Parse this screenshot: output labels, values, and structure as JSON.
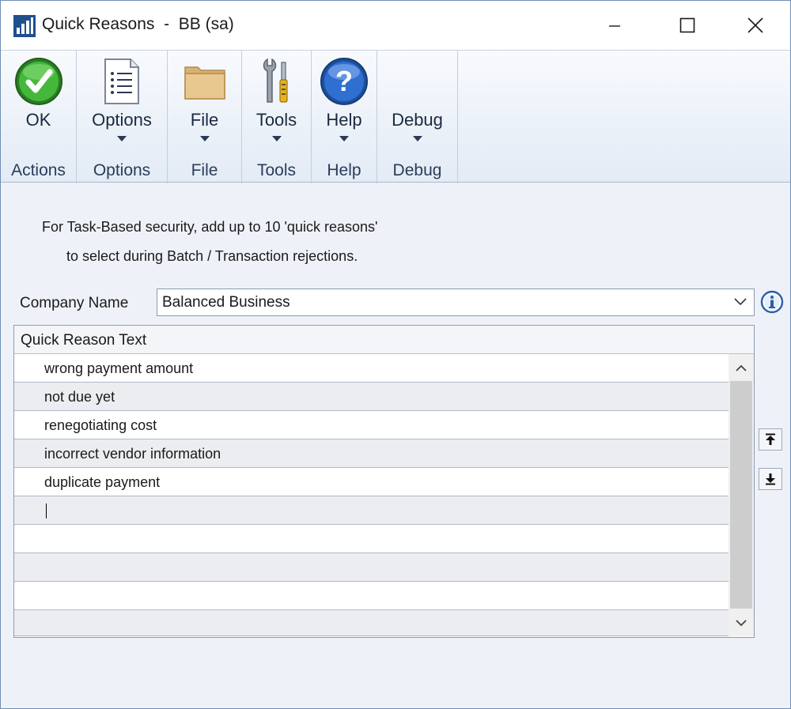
{
  "window": {
    "app_name": "Quick Reasons",
    "separator": "-",
    "context": "BB (sa)"
  },
  "ribbon": {
    "buttons": [
      {
        "label": "OK",
        "icon": "ok-check-icon",
        "group": "Actions"
      },
      {
        "label": "Options",
        "icon": "options-list-icon",
        "group": "Options"
      },
      {
        "label": "File",
        "icon": "folder-icon",
        "group": "File"
      },
      {
        "label": "Tools",
        "icon": "tools-icon",
        "group": "Tools"
      },
      {
        "label": "Help",
        "icon": "help-icon",
        "group": "Help"
      },
      {
        "label": "Debug",
        "icon": "",
        "group": "Debug"
      }
    ]
  },
  "instructions": {
    "line1": "For Task-Based security, add up to 10 'quick reasons'",
    "line2": "to select during Batch / Transaction rejections."
  },
  "company": {
    "label": "Company Name",
    "value": "Balanced Business"
  },
  "grid": {
    "header": "Quick Reason Text",
    "rows": [
      "wrong payment amount",
      "not due yet",
      "renegotiating cost",
      "incorrect vendor information",
      "duplicate payment",
      "",
      "",
      "",
      "",
      ""
    ]
  },
  "colors": {
    "accent": "#2e6db4",
    "ok_green": "#3aa533",
    "help_blue": "#2a64c4",
    "ribbon_bg": "#e3ebf6"
  }
}
